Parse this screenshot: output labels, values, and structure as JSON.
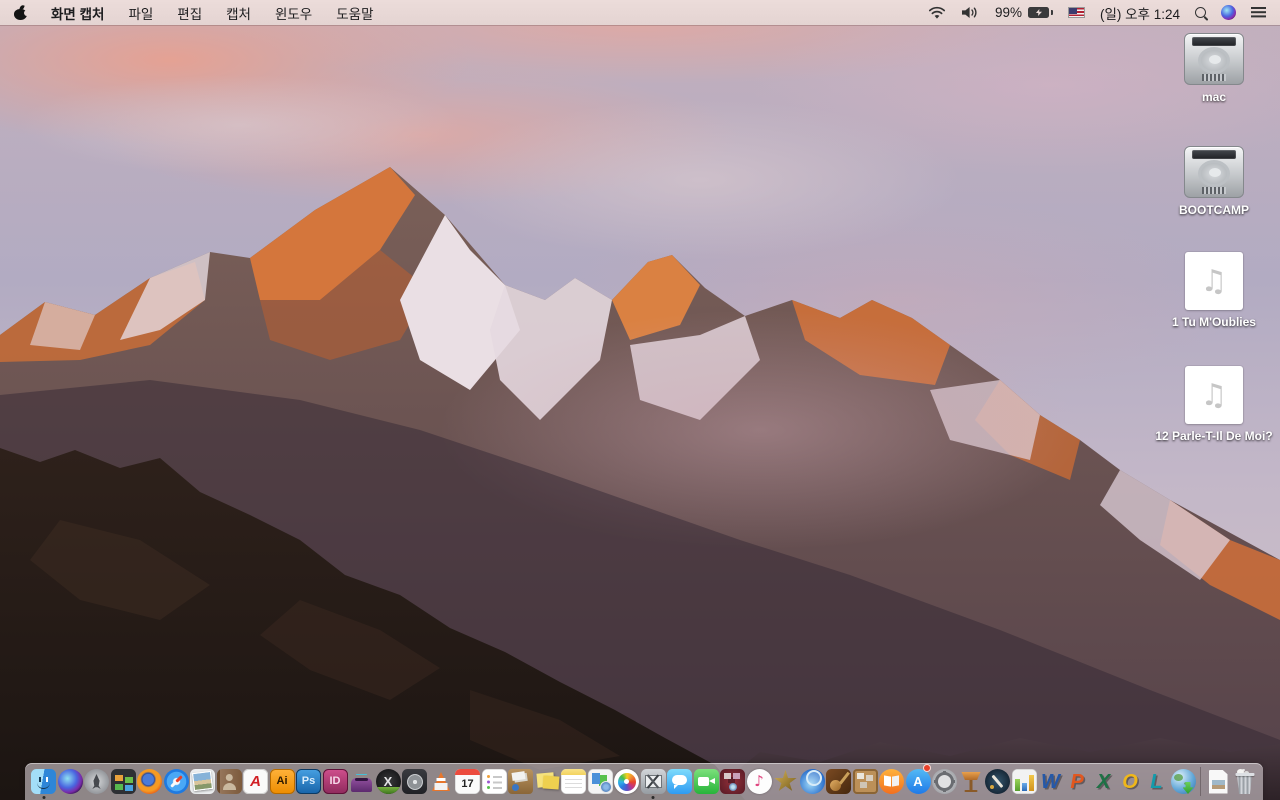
{
  "menu_bar": {
    "app_name": "화면 캡처",
    "menus": [
      {
        "name": "file",
        "label": "파일"
      },
      {
        "name": "edit",
        "label": "편집"
      },
      {
        "name": "capture",
        "label": "캡처"
      },
      {
        "name": "window",
        "label": "윈도우"
      },
      {
        "name": "help",
        "label": "도움말"
      }
    ],
    "battery_percent": "99%",
    "clock": "(일) 오후 1:24"
  },
  "desktop": {
    "audio_glyph": "♫",
    "icons": [
      {
        "name": "volume-mac",
        "type": "hdd",
        "label": "mac"
      },
      {
        "name": "volume-bootcamp",
        "type": "hdd",
        "label": "BOOTCAMP"
      },
      {
        "name": "audio-file-1",
        "type": "audio",
        "label": "1 Tu M'Oublies"
      },
      {
        "name": "audio-file-2",
        "type": "audio",
        "label": "12 Parle-T-Il De Moi?"
      }
    ]
  },
  "dock": {
    "items": [
      {
        "name": "finder",
        "running": true
      },
      {
        "name": "siri"
      },
      {
        "name": "launchpad"
      },
      {
        "name": "mission-control"
      },
      {
        "name": "firefox"
      },
      {
        "name": "safari"
      },
      {
        "name": "preview"
      },
      {
        "name": "contacts"
      },
      {
        "name": "acrobat",
        "glyph": "A"
      },
      {
        "name": "illustrator",
        "glyph": "Ai"
      },
      {
        "name": "photoshop",
        "glyph": "Ps"
      },
      {
        "name": "indesign",
        "glyph": "ID"
      },
      {
        "name": "toast"
      },
      {
        "name": "x-media",
        "glyph": "X"
      },
      {
        "name": "disk-tool"
      },
      {
        "name": "vlc"
      },
      {
        "name": "calendar",
        "glyph": "17"
      },
      {
        "name": "reminders"
      },
      {
        "name": "mail-archive"
      },
      {
        "name": "stickies"
      },
      {
        "name": "notes"
      },
      {
        "name": "documents"
      },
      {
        "name": "photos"
      },
      {
        "name": "screen-capture",
        "running": true
      },
      {
        "name": "messages"
      },
      {
        "name": "facetime"
      },
      {
        "name": "photo-booth"
      },
      {
        "name": "itunes",
        "glyph": "♪"
      },
      {
        "name": "star-app"
      },
      {
        "name": "media-player"
      },
      {
        "name": "garageband"
      },
      {
        "name": "corkboard"
      },
      {
        "name": "ibooks"
      },
      {
        "name": "app-store",
        "glyph": "A",
        "badge": true
      },
      {
        "name": "system-preferences"
      },
      {
        "name": "keynote"
      },
      {
        "name": "pages"
      },
      {
        "name": "numbers"
      },
      {
        "name": "word",
        "glyph": "W"
      },
      {
        "name": "powerpoint",
        "glyph": "P"
      },
      {
        "name": "excel",
        "glyph": "X"
      },
      {
        "name": "outlook",
        "glyph": "O"
      },
      {
        "name": "lync",
        "glyph": "L"
      },
      {
        "name": "ms-autoupdate"
      },
      {
        "name": "divider",
        "divider": true
      },
      {
        "name": "document-file"
      },
      {
        "name": "trash"
      }
    ]
  },
  "colors": {
    "menubar_bg": "#e8d9d7",
    "dock_bg": "rgba(213,203,208,0.62)",
    "sky_lavender": "#b3abc2",
    "cloud_pink": "#e8a49a",
    "sunlit_rock": "#d4763f",
    "shadow_rock": "#4e3b3c",
    "foreground_rock": "#241a15",
    "snow": "#e9dde2"
  }
}
